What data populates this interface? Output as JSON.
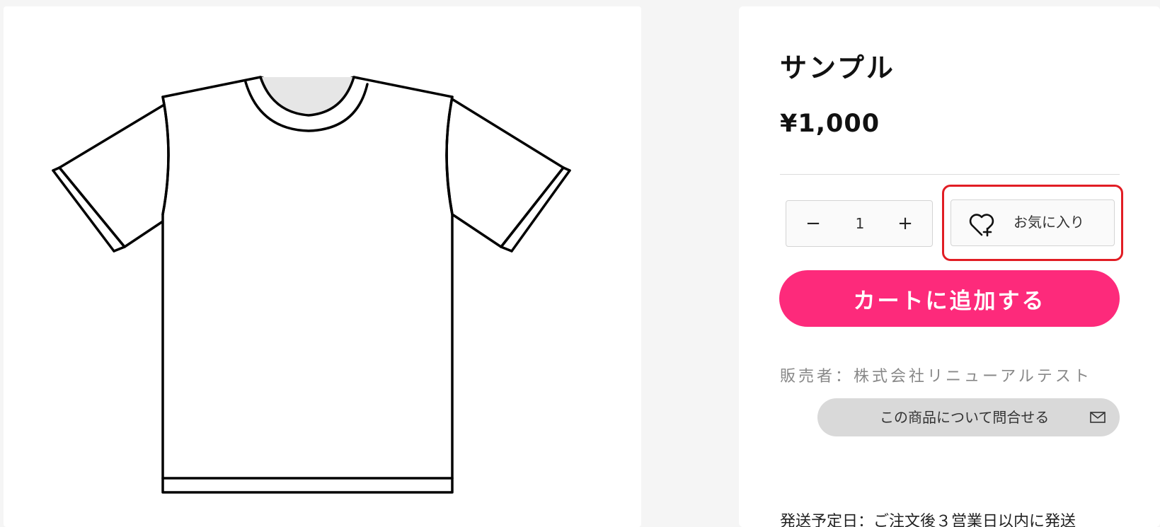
{
  "product": {
    "image_alt": "T-shirt illustration",
    "title": "サンプル",
    "price": "¥1,000"
  },
  "quantity": {
    "minus_label": "−",
    "value": "1",
    "plus_label": "+"
  },
  "favorite": {
    "label": "お気に入り",
    "icon": "heart-plus-icon",
    "highlight_color": "#e11d24"
  },
  "cart": {
    "label": "カートに追加する",
    "color": "#fd2a7b"
  },
  "seller": {
    "text": "販売者：株式会社リニューアルテスト"
  },
  "inquiry": {
    "label": "この商品について問合せる",
    "icon": "mail-icon"
  },
  "shipping": {
    "text": "発送予定日：ご注文後３営業日以内に発送"
  }
}
